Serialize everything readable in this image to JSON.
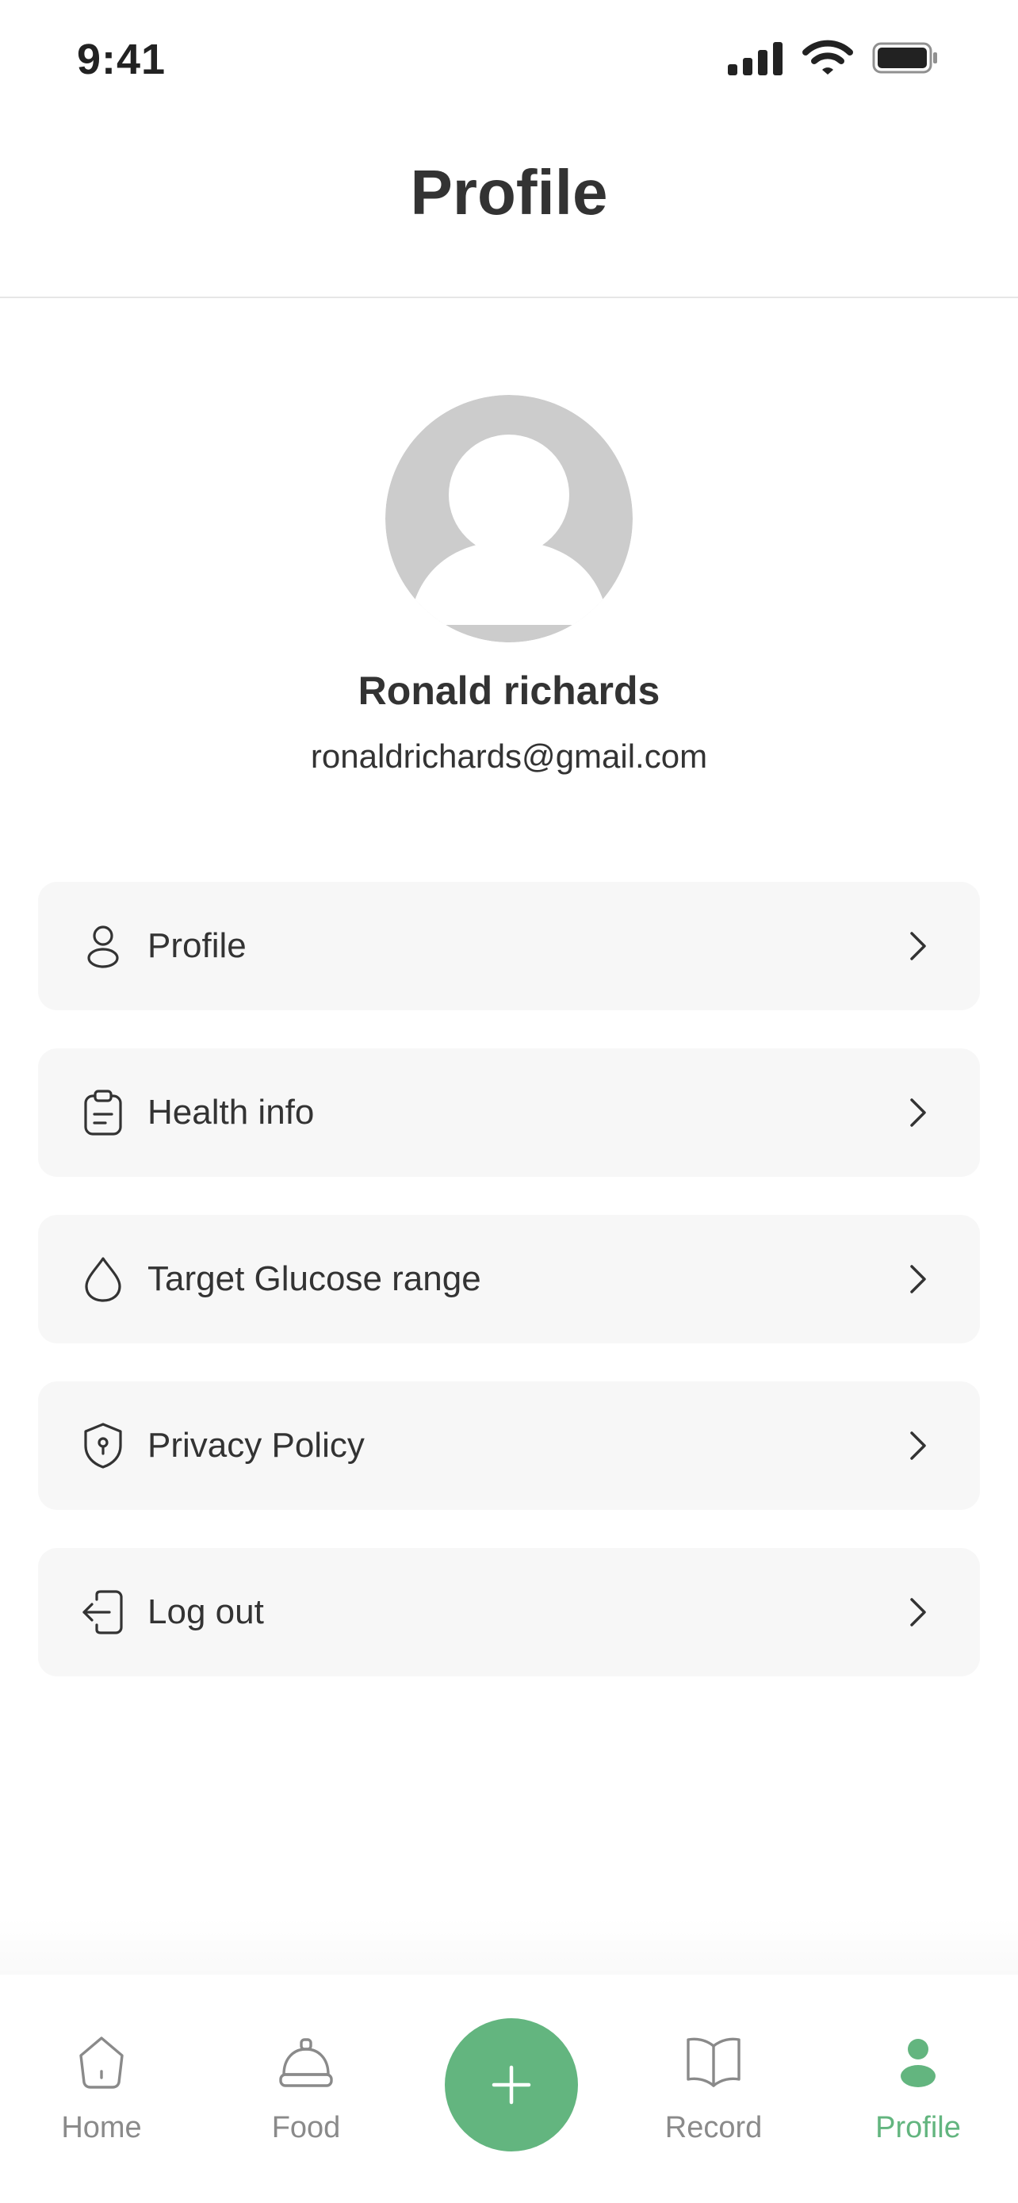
{
  "status_bar": {
    "time": "9:41",
    "icons": [
      "cellular-signal-icon",
      "wifi-icon",
      "battery-icon"
    ]
  },
  "header": {
    "title": "Profile"
  },
  "user": {
    "avatar_icon": "default-avatar-icon",
    "name": "Ronald richards",
    "email": "ronaldrichards@gmail.com"
  },
  "menu": {
    "items": [
      {
        "label": "Profile",
        "icon": "user-icon"
      },
      {
        "label": "Health info",
        "icon": "clipboard-icon"
      },
      {
        "label": "Target Glucose range",
        "icon": "droplet-icon"
      },
      {
        "label": "Privacy Policy",
        "icon": "shield-icon"
      },
      {
        "label": "Log out",
        "icon": "logout-icon"
      }
    ],
    "chevron_icon": "chevron-right-icon"
  },
  "bottom_nav": {
    "items": [
      {
        "label": "Home",
        "icon": "home-icon"
      },
      {
        "label": "Food",
        "icon": "cloche-icon"
      },
      {
        "label": "Record",
        "icon": "book-icon"
      },
      {
        "label": "Profile",
        "icon": "user-filled-icon",
        "active": true
      }
    ],
    "fab_icon": "plus-icon"
  },
  "colors": {
    "accent": "#63b57f",
    "text_primary": "#333333",
    "text_muted": "#8a8a8a",
    "card_bg": "#f7f7f7",
    "avatar_bg": "#cccccc"
  }
}
